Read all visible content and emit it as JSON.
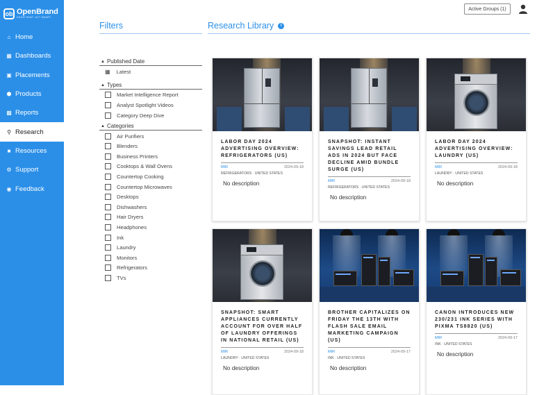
{
  "brand": {
    "name": "OpenBrand",
    "tagline": "KNOW WHAT. ACT SMART."
  },
  "nav": {
    "items": [
      {
        "label": "Home",
        "icon": "home-icon"
      },
      {
        "label": "Dashboards",
        "icon": "dashboard-icon"
      },
      {
        "label": "Placements",
        "icon": "placements-icon"
      },
      {
        "label": "Products",
        "icon": "products-icon"
      },
      {
        "label": "Reports",
        "icon": "reports-icon"
      },
      {
        "label": "Research",
        "icon": "search-icon",
        "active": true
      },
      {
        "label": "Resources",
        "icon": "resources-icon"
      },
      {
        "label": "Support",
        "icon": "support-icon"
      },
      {
        "label": "Feedback",
        "icon": "feedback-icon"
      }
    ]
  },
  "header": {
    "active_groups": "Active Groups (1)"
  },
  "filters": {
    "title": "Filters",
    "published": {
      "title": "Published Date",
      "option": "Latest"
    },
    "types": {
      "title": "Types",
      "options": [
        "Market Intelligence Report",
        "Analyst Spotlight Videos",
        "Category Deep Dive"
      ]
    },
    "categories": {
      "title": "Categories",
      "options": [
        "Air Purifiers",
        "Blenders",
        "Business Printers",
        "Cooktops & Wall Ovens",
        "Countertop Cooking",
        "Countertop Microwaves",
        "Desktops",
        "Dishwashers",
        "Hair Dryers",
        "Headphones",
        "Ink",
        "Laundry",
        "Monitors",
        "Refrigerators",
        "TVs"
      ]
    }
  },
  "library": {
    "title": "Research Library",
    "cards": [
      {
        "title": "Labor Day 2024 Advertising Overview: Refrigerators (US)",
        "source": "MIR",
        "date": "2024-09-18",
        "cats": "REFRIGERATORS · UNITED STATES",
        "desc": "No description",
        "image": "refrigerator"
      },
      {
        "title": "Snapshot: Instant Savings Lead Retail Ads in 2024 But Face Decline Amid Bundle Surge (US)",
        "source": "MIR",
        "date": "2024-09-18",
        "cats": "REFRIGERATORS · UNITED STATES",
        "desc": "No description",
        "image": "refrigerator"
      },
      {
        "title": "Labor Day 2024 Advertising Overview: Laundry (US)",
        "source": "MIR",
        "date": "2024-09-18",
        "cats": "LAUNDRY · UNITED STATES",
        "desc": "No description",
        "image": "washer"
      },
      {
        "title": "Snapshot: Smart Appliances Currently Account for Over Half of Laundry Offerings in National Retail (US)",
        "source": "MIR",
        "date": "2024-09-18",
        "cats": "LAUNDRY · UNITED STATES",
        "desc": "No description",
        "image": "washer"
      },
      {
        "title": "Brother Capitalizes on Friday the 13th with Flash Sale Email Marketing Campaign (US)",
        "source": "MIR",
        "date": "2024-09-17",
        "cats": "INK · UNITED STATES",
        "desc": "No description",
        "image": "printers"
      },
      {
        "title": "Canon Introduces New 230/231 Ink Series with PIXMA TS8820 (US)",
        "source": "MIR",
        "date": "2024-09-17",
        "cats": "INK · UNITED STATES",
        "desc": "No description",
        "image": "printers"
      }
    ]
  }
}
